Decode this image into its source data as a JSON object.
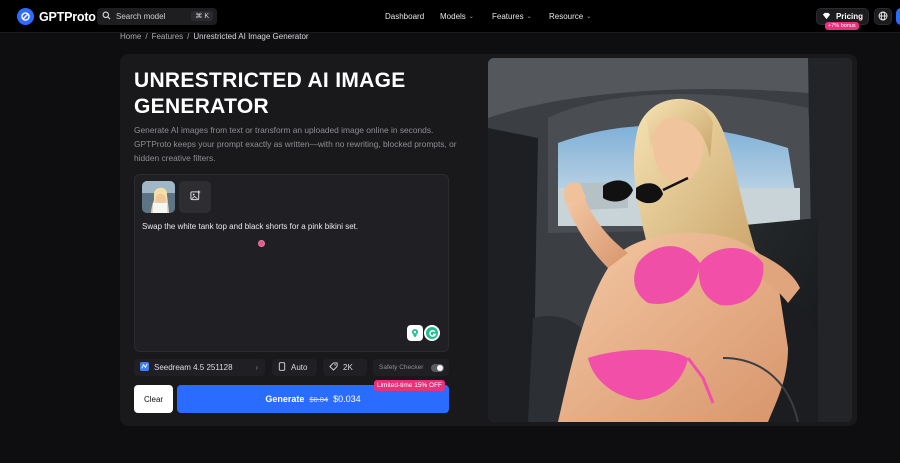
{
  "nav": {
    "brand": "GPTProto",
    "search_placeholder": "Search model",
    "search_shortcut": "⌘ K",
    "menu": [
      {
        "label": "Dashboard",
        "has_caret": false
      },
      {
        "label": "Models",
        "has_caret": true
      },
      {
        "label": "Features",
        "has_caret": true
      },
      {
        "label": "Resource",
        "has_caret": true
      }
    ],
    "pricing_label": "Pricing",
    "pricing_badge": "+7% bonus"
  },
  "breadcrumb": {
    "items": [
      "Home",
      "Features",
      "Unrestricted AI Image Generator"
    ],
    "separator": "/"
  },
  "hero": {
    "title": "UNRESTRICTED AI IMAGE GENERATOR",
    "description": "Generate AI images from text or transform an uploaded image online in seconds. GPTProto keeps your prompt exactly as written—with no rewriting, blocked prompts, or hidden creative filters."
  },
  "editor": {
    "prompt": "Swap the white tank top and black shorts for a pink bikini set."
  },
  "options": {
    "model": "Seedream 4.5 251128",
    "aspect": "Auto",
    "resolution": "2K",
    "safety_label": "Safety Checker",
    "safety_enabled": false,
    "promo": "Limited-time 15% OFF"
  },
  "actions": {
    "clear_label": "Clear",
    "generate_label": "Generate",
    "old_price": "$0.04",
    "new_price": "$0.034"
  },
  "colors": {
    "accent": "#2a6cff",
    "promo": "#e8317c",
    "panel": "#19191c"
  }
}
